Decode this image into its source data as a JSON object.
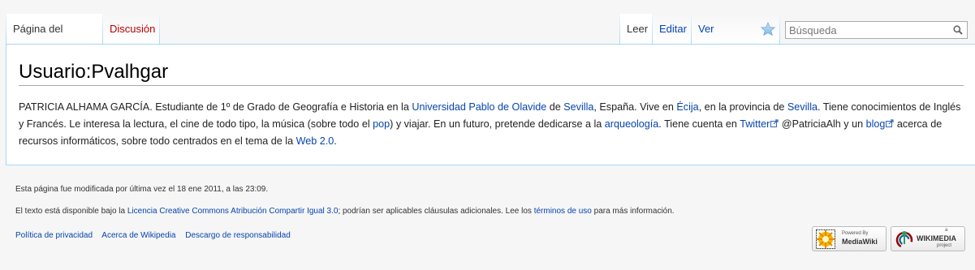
{
  "tabs_left": [
    {
      "label": "Página del usuario"
    },
    {
      "label": "Discusión"
    }
  ],
  "tabs_right": [
    {
      "label": "Leer"
    },
    {
      "label": "Editar"
    },
    {
      "label": "Ver historial"
    }
  ],
  "search": {
    "placeholder": "Búsqueda"
  },
  "page": {
    "title": "Usuario:Pvalhgar",
    "body": {
      "t1": "PATRICIA ALHAMA GARCÍA. Estudiante de 1º de Grado de Geografía e Historia en la ",
      "l1": "Universidad Pablo de Olavide",
      "t2": " de ",
      "l2": "Sevilla",
      "t3": ", España. Vive en ",
      "l3": "Écija",
      "t4": ", en la provincia de ",
      "l4": "Sevilla",
      "t5": ". Tiene conocimientos de Inglés y Francés. Le interesa la lectura, el cine de todo tipo, la música (sobre todo el ",
      "l5": "pop",
      "t6": ") y viajar. En un futuro, pretende dedicarse a la ",
      "l6": "arqueología",
      "t7": ". Tiene cuenta en ",
      "l7": "Twitter",
      "t8": " @PatriciaAlh y un ",
      "l8": "blog",
      "t9": " acerca de recursos informáticos, sobre todo centrados en el tema de la ",
      "l9": "Web 2.0",
      "t10": "."
    }
  },
  "footer": {
    "lastmod": "Esta página fue modificada por última vez el 18 ene 2011, a las 23:09.",
    "license_pre": "El texto está disponible bajo la ",
    "license_link": "Licencia Creative Commons Atribución Compartir Igual 3.0",
    "license_mid": "; podrían ser aplicables cláusulas adicionales. Lee los ",
    "terms_link": "términos de uso",
    "license_post": " para más información.",
    "links": [
      {
        "label": "Política de privacidad"
      },
      {
        "label": "Acerca de Wikipedia"
      },
      {
        "label": "Descargo de responsabilidad"
      }
    ],
    "badges": {
      "mediawiki_top": "Powered By",
      "mediawiki": "MediaWiki",
      "wikimedia_top": "a",
      "wikimedia": "WIKIMEDIA",
      "wikimedia_bottom": "project"
    }
  },
  "colors": {
    "link": "#0645ad",
    "new_link": "#ba0000",
    "tab_border": "#a7d7f9",
    "background": "#f6f6f6"
  },
  "icons": [
    "watch-star-icon",
    "search-icon",
    "external-link-icon",
    "mediawiki-logo-icon",
    "wikimedia-logo-icon"
  ]
}
